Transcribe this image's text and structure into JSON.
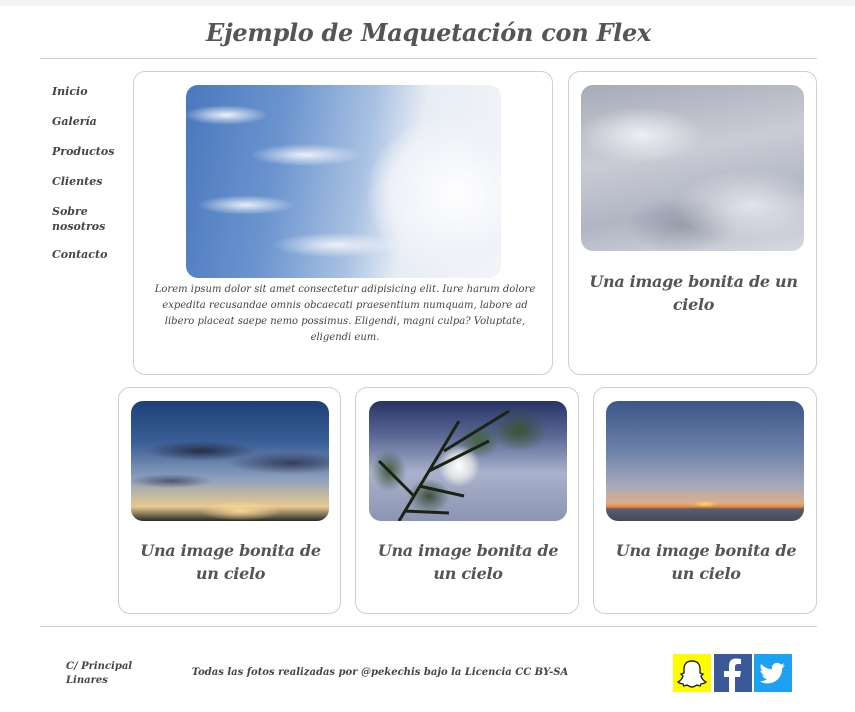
{
  "header": {
    "title": "Ejemplo de Maquetación con Flex"
  },
  "nav": {
    "items": [
      "Inicio",
      "Galería",
      "Productos",
      "Clientes",
      "Sobre nosotros",
      "Contacto"
    ]
  },
  "main": {
    "feature_text": "Lorem ipsum dolor sit amet consectetur adipisicing elit. Iure harum dolore expedita recusandae omnis obcaecati praesentium numquam, labore ad libero placeat saepe nemo possimus. Eligendi, magni culpa? Voluptate, eligendi eum.",
    "captions": [
      "Una image bonita de un cielo",
      "Una image bonita de un cielo",
      "Una image bonita de un cielo",
      "Una image bonita de un cielo"
    ]
  },
  "footer": {
    "address_line1": "C/ Principal",
    "address_line2": "Linares",
    "credits": "Todas las fotos realizadas por @pekechis bajo la Licencia CC BY-SA",
    "social": [
      {
        "name": "snapchat",
        "color": "#fffc00"
      },
      {
        "name": "facebook",
        "color": "#3b5998"
      },
      {
        "name": "twitter",
        "color": "#1da1f2"
      }
    ]
  }
}
